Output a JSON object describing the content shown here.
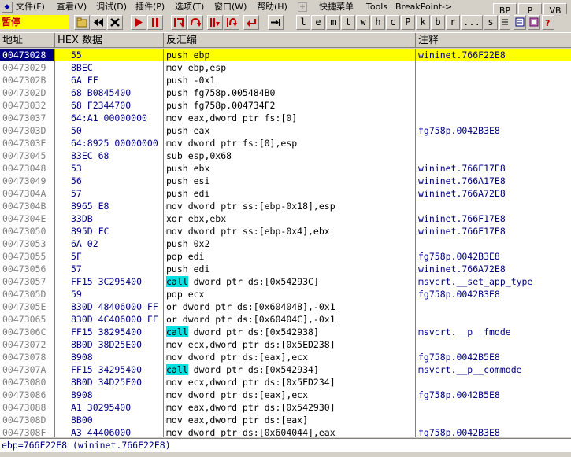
{
  "menu": [
    "文件(F)",
    "查看(V)",
    "调试(D)",
    "插件(P)",
    "选项(T)",
    "窗口(W)",
    "帮助(H)",
    "快捷菜单",
    "Tools",
    "BreakPoint->"
  ],
  "menu_sep_glyph": "+",
  "right_buttons": [
    "BP",
    "P",
    "VB"
  ],
  "toolbar": {
    "status": "暂停",
    "letters": [
      "l",
      "e",
      "m",
      "t",
      "w",
      "h",
      "c",
      "P",
      "k",
      "b",
      "r",
      "...",
      "s"
    ]
  },
  "columns": {
    "addr": "地址",
    "hex": "HEX 数据",
    "asm": "反汇编",
    "comment": "注释"
  },
  "rows": [
    {
      "addr": "00473028",
      "hex": "55",
      "asm": "push ebp",
      "cmt": "wininet.766F22E8",
      "selected": true
    },
    {
      "addr": "00473029",
      "hex": "8BEC",
      "asm": "mov ebp,esp",
      "cmt": ""
    },
    {
      "addr": "0047302B",
      "hex": "6A FF",
      "asm": "push -0x1",
      "cmt": ""
    },
    {
      "addr": "0047302D",
      "hex": "68 B0845400",
      "asm": "push fg758p.005484B0",
      "cmt": ""
    },
    {
      "addr": "00473032",
      "hex": "68 F2344700",
      "asm": "push fg758p.004734F2",
      "cmt": ""
    },
    {
      "addr": "00473037",
      "hex": "64:A1 00000000",
      "asm": "mov eax,dword ptr fs:[0]",
      "cmt": ""
    },
    {
      "addr": "0047303D",
      "hex": "50",
      "asm": "push eax",
      "cmt": "fg758p.0042B3E8"
    },
    {
      "addr": "0047303E",
      "hex": "64:8925 00000000",
      "asm": "mov dword ptr fs:[0],esp",
      "cmt": ""
    },
    {
      "addr": "00473045",
      "hex": "83EC 68",
      "asm": "sub esp,0x68",
      "cmt": ""
    },
    {
      "addr": "00473048",
      "hex": "53",
      "asm": "push ebx",
      "cmt": "wininet.766F17E8"
    },
    {
      "addr": "00473049",
      "hex": "56",
      "asm": "push esi",
      "cmt": "wininet.766A17E8"
    },
    {
      "addr": "0047304A",
      "hex": "57",
      "asm": "push edi",
      "cmt": "wininet.766A72E8"
    },
    {
      "addr": "0047304B",
      "hex": "8965 E8",
      "asm": "mov dword ptr ss:[ebp-0x18],esp",
      "cmt": ""
    },
    {
      "addr": "0047304E",
      "hex": "33DB",
      "asm": "xor ebx,ebx",
      "cmt": "wininet.766F17E8"
    },
    {
      "addr": "00473050",
      "hex": "895D FC",
      "asm": "mov dword ptr ss:[ebp-0x4],ebx",
      "cmt": "wininet.766F17E8"
    },
    {
      "addr": "00473053",
      "hex": "6A 02",
      "asm": "push 0x2",
      "cmt": ""
    },
    {
      "addr": "00473055",
      "hex": "5F",
      "asm": "pop edi",
      "cmt": "fg758p.0042B3E8"
    },
    {
      "addr": "00473056",
      "hex": "57",
      "asm": "push edi",
      "cmt": "wininet.766A72E8"
    },
    {
      "addr": "00473057",
      "hex": "FF15 3C295400",
      "kw": "call",
      "asm": "dword ptr ds:[0x54293C]",
      "cmt": "msvcrt.__set_app_type"
    },
    {
      "addr": "0047305D",
      "hex": "59",
      "asm": "pop ecx",
      "cmt": "fg758p.0042B3E8"
    },
    {
      "addr": "0047305E",
      "hex": "830D 48406000 FF",
      "asm": "or dword ptr ds:[0x604048],-0x1",
      "cmt": ""
    },
    {
      "addr": "00473065",
      "hex": "830D 4C406000 FF",
      "asm": "or dword ptr ds:[0x60404C],-0x1",
      "cmt": ""
    },
    {
      "addr": "0047306C",
      "hex": "FF15 38295400",
      "kw": "call",
      "asm": "dword ptr ds:[0x542938]",
      "cmt": "msvcrt.__p__fmode"
    },
    {
      "addr": "00473072",
      "hex": "8B0D 38D25E00",
      "asm": "mov ecx,dword ptr ds:[0x5ED238]",
      "cmt": ""
    },
    {
      "addr": "00473078",
      "hex": "8908",
      "asm": "mov dword ptr ds:[eax],ecx",
      "cmt": "fg758p.0042B5E8"
    },
    {
      "addr": "0047307A",
      "hex": "FF15 34295400",
      "kw": "call",
      "asm": "dword ptr ds:[0x542934]",
      "cmt": "msvcrt.__p__commode"
    },
    {
      "addr": "00473080",
      "hex": "8B0D 34D25E00",
      "asm": "mov ecx,dword ptr ds:[0x5ED234]",
      "cmt": ""
    },
    {
      "addr": "00473086",
      "hex": "8908",
      "asm": "mov dword ptr ds:[eax],ecx",
      "cmt": "fg758p.0042B5E8"
    },
    {
      "addr": "00473088",
      "hex": "A1 30295400",
      "asm": "mov eax,dword ptr ds:[0x542930]",
      "cmt": ""
    },
    {
      "addr": "0047308D",
      "hex": "8B00",
      "asm": "mov eax,dword ptr ds:[eax]",
      "cmt": ""
    },
    {
      "addr": "0047308F",
      "hex": "A3 44406000",
      "asm": "mov dword ptr ds:[0x604044],eax",
      "cmt": "fg758p.0042B3E8"
    }
  ],
  "info_line": "ebp=766F22E8 (wininet.766F22E8)",
  "colors": {
    "selected_row": "#ffff00",
    "selected_addr": "#000080",
    "call_highlight": "#00e0e0",
    "status_bg": "#ffff00"
  }
}
